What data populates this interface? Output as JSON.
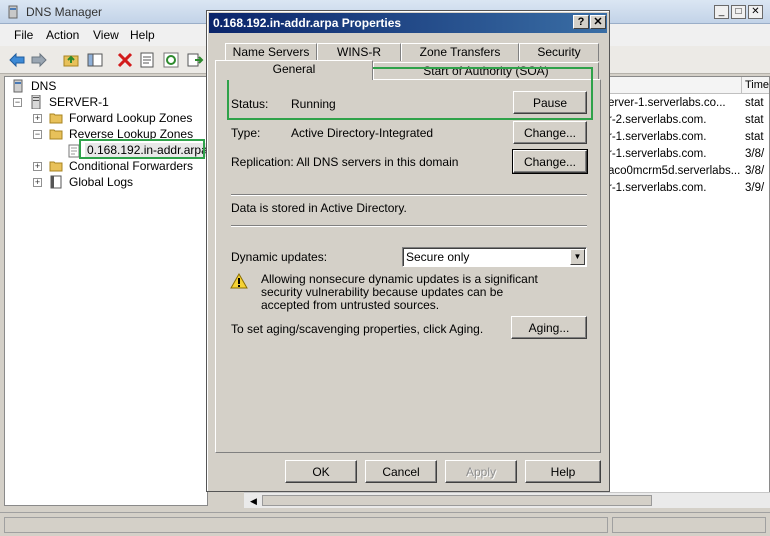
{
  "app": {
    "title": "DNS Manager",
    "menu": [
      "File",
      "Action",
      "View",
      "Help"
    ],
    "window_buttons": [
      "_",
      "□",
      "✕"
    ]
  },
  "tree": {
    "items": [
      {
        "label": "DNS",
        "icon": "dns-icon"
      },
      {
        "label": "SERVER-1",
        "icon": "server-icon"
      },
      {
        "label": "Forward Lookup Zones",
        "icon": "folder-icon"
      },
      {
        "label": "Reverse Lookup Zones",
        "icon": "folder-icon"
      },
      {
        "label": "0.168.192.in-addr.arpa",
        "icon": "zone-icon"
      },
      {
        "label": "Conditional Forwarders",
        "icon": "folder-icon"
      },
      {
        "label": "Global Logs",
        "icon": "logs-icon"
      }
    ]
  },
  "list": {
    "header_time": "Time",
    "rows": [
      {
        "data": "erver-1.serverlabs.co...",
        "time": "stat"
      },
      {
        "data": "r-2.serverlabs.com.",
        "time": "stat"
      },
      {
        "data": "r-1.serverlabs.com.",
        "time": "stat"
      },
      {
        "data": "r-1.serverlabs.com.",
        "time": "3/8/"
      },
      {
        "data": "aco0mcrm5d.serverlabs...",
        "time": "3/8/"
      },
      {
        "data": "r-1.serverlabs.com.",
        "time": "3/9/"
      }
    ]
  },
  "dialog": {
    "title": "0.168.192.in-addr.arpa Properties",
    "help_btn": "?",
    "close_btn": "✕",
    "tabs_row1": [
      "Name Servers",
      "WINS-R",
      "Zone Transfers",
      "Security"
    ],
    "tabs_row2": [
      "General",
      "Start of Authority (SOA)"
    ],
    "status_label": "Status:",
    "status_value": "Running",
    "pause_btn": "Pause",
    "type_label": "Type:",
    "type_value": "Active Directory-Integrated",
    "change_btn_1": "Change...",
    "replication_text": "Replication: All DNS servers in this domain",
    "change_btn_2": "Change...",
    "stored_text": "Data is stored in Active Directory.",
    "dynamic_label": "Dynamic updates:",
    "dynamic_value": "Secure only",
    "warning_text": "Allowing nonsecure dynamic updates is a significant security vulnerability because updates can be accepted from untrusted sources.",
    "aging_text": "To set aging/scavenging properties, click Aging.",
    "aging_btn": "Aging...",
    "ok_btn": "OK",
    "cancel_btn": "Cancel",
    "apply_btn": "Apply",
    "help_bottom_btn": "Help"
  },
  "colors": {
    "highlight": "#2fa24a",
    "dialog_title": "#0a246a"
  }
}
